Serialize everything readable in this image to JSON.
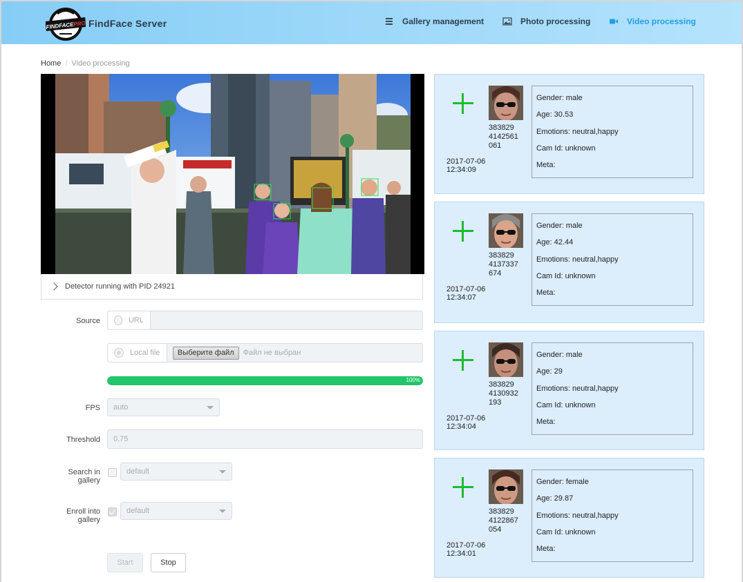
{
  "header": {
    "app_title": "FindFace Server",
    "logo_text": "FINDFACEPRO",
    "nav": [
      {
        "label": "Gallery management",
        "icon": "list-icon",
        "active": false
      },
      {
        "label": "Photo processing",
        "icon": "image-icon",
        "active": false
      },
      {
        "label": "Video processing",
        "icon": "video-camera-icon",
        "active": true
      }
    ],
    "accent_color": "#1f9fe6"
  },
  "breadcrumb": {
    "home": "Home",
    "current": "Video processing"
  },
  "detector": {
    "status": "Detector running with PID 24921"
  },
  "form": {
    "source_label": "Source",
    "url_option": "URL",
    "url_value": "",
    "local_option": "Local file",
    "file_button": "Выберите файл",
    "file_name": "Файл не выбран",
    "progress_percent": 100,
    "progress_text": "100%",
    "fps_label": "FPS",
    "fps_value": "auto",
    "threshold_label": "Threshold",
    "threshold_placeholder": "0.75",
    "search_label_line1": "Search in",
    "search_label_line2": "gallery",
    "search_checked": false,
    "search_gallery": "default",
    "enroll_label_line1": "Enroll into",
    "enroll_label_line2": "gallery",
    "enroll_checked": true,
    "enroll_gallery": "default",
    "start_label": "Start",
    "stop_label": "Stop"
  },
  "detections": [
    {
      "id_lines": [
        "383829",
        "4142561",
        "061"
      ],
      "date": "2017-07-06",
      "time": "12:34:09",
      "gender": "Gender: male",
      "age": "Age: 30.53",
      "emotions": "Emotions: neutral,happy",
      "cam": "Cam Id: unknown",
      "meta": "Meta:"
    },
    {
      "id_lines": [
        "383829",
        "4137337",
        "674"
      ],
      "date": "2017-07-06",
      "time": "12:34:07",
      "gender": "Gender: male",
      "age": "Age: 42.44",
      "emotions": "Emotions: neutral,happy",
      "cam": "Cam Id: unknown",
      "meta": "Meta:"
    },
    {
      "id_lines": [
        "383829",
        "4130932",
        "193"
      ],
      "date": "2017-07-06",
      "time": "12:34:04",
      "gender": "Gender: male",
      "age": "Age: 29",
      "emotions": "Emotions: neutral,happy",
      "cam": "Cam Id: unknown",
      "meta": "Meta:"
    },
    {
      "id_lines": [
        "383829",
        "4122867",
        "054"
      ],
      "date": "2017-07-06",
      "time": "12:34:01",
      "gender": "Gender: female",
      "age": "Age: 29.87",
      "emotions": "Emotions: neutral,happy",
      "cam": "Cam Id: unknown",
      "meta": "Meta:"
    }
  ]
}
